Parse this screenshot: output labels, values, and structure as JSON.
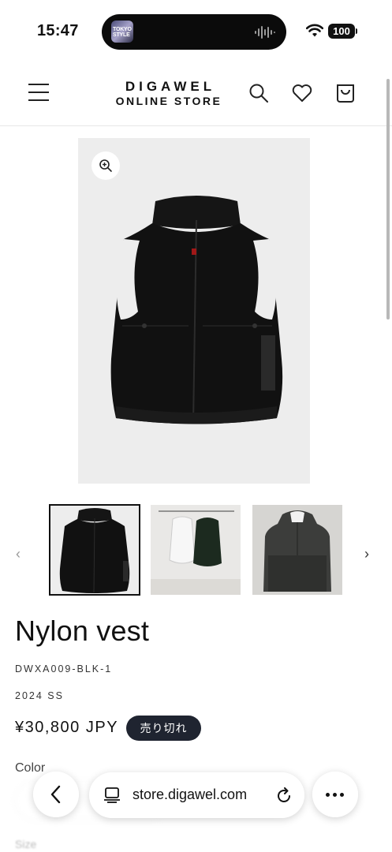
{
  "status_bar": {
    "time": "15:47",
    "battery": "100",
    "now_playing_thumb_text": "TOKYO STYLE"
  },
  "header": {
    "logo_line1": "DIGAWEL",
    "logo_line2": "ONLINE STORE",
    "icons": [
      "menu-icon",
      "search-icon",
      "heart-icon",
      "cart-icon"
    ]
  },
  "gallery": {
    "zoom_icon": "zoom-in-icon",
    "prev_arrow": "‹",
    "next_arrow": "›",
    "thumbnails": [
      "black nylon vest front",
      "white and black vests on rack",
      "vest worn on hanger"
    ]
  },
  "product": {
    "title": "Nylon vest",
    "sku": "DWXA009-BLK-1",
    "season": "2024 SS",
    "price": "¥30,800 JPY",
    "badge": "売り切れ",
    "color_label": "Color",
    "size_label": "Size"
  },
  "browser": {
    "url": "store.digawel.com",
    "back_icon": "chevron-left-icon",
    "tabs_icon": "tabs-icon",
    "reload_icon": "reload-icon",
    "more_icon": "more-icon"
  },
  "colors": {
    "badge_bg": "#1f2430",
    "image_bg": "#ededed"
  }
}
